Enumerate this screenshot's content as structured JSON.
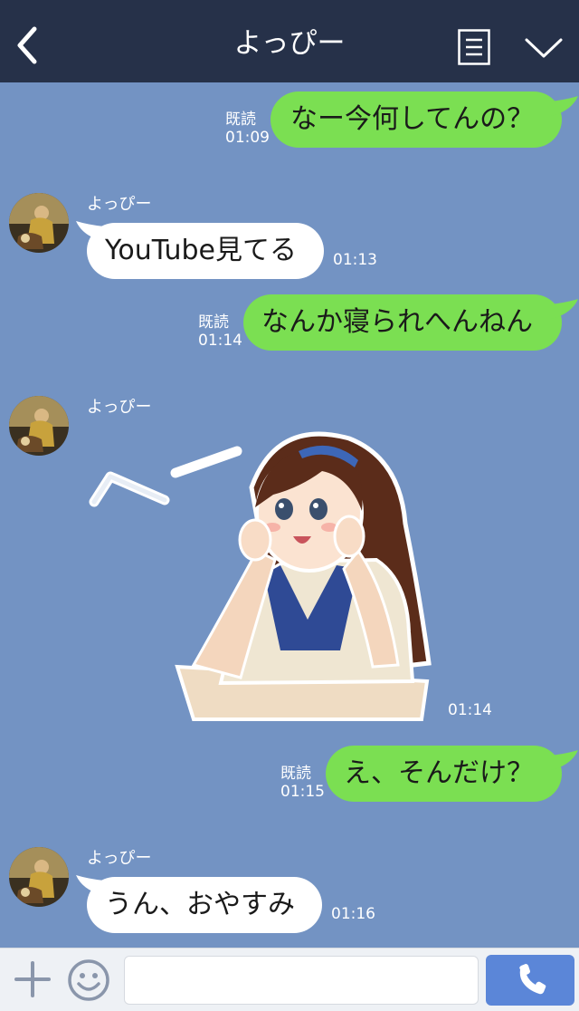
{
  "header": {
    "title": "よっぴー",
    "back_icon": "chevron-left-icon",
    "menu_icon": "notes-icon",
    "collapse_icon": "chevron-down-icon",
    "background": "#263149"
  },
  "chat": {
    "background": "#7393c3",
    "messages": [
      {
        "direction": "outgoing",
        "text": "なー今何してんの？",
        "read_label": "既読",
        "time": "01:09"
      },
      {
        "direction": "incoming",
        "sender": "よっぴー",
        "text": "YouTube見てる",
        "time": "01:13"
      },
      {
        "direction": "outgoing",
        "text": "なんか寝られへんねん",
        "read_label": "既読",
        "time": "01:14"
      },
      {
        "direction": "incoming",
        "sender": "よっぴー",
        "type": "sticker",
        "sticker_text": "へー",
        "time": "01:14"
      },
      {
        "direction": "outgoing",
        "text": "え、そんだけ？",
        "read_label": "既読",
        "time": "01:15"
      },
      {
        "direction": "incoming",
        "sender": "よっぴー",
        "text": "うん、おやすみ",
        "time": "01:16"
      }
    ]
  },
  "input_bar": {
    "plus_icon": "plus-icon",
    "emoji_icon": "smiley-icon",
    "placeholder": "",
    "value": "",
    "call_icon": "phone-icon"
  },
  "colors": {
    "outgoing_bubble": "#7bdf52",
    "incoming_bubble": "#ffffff",
    "call_button": "#5b86d8"
  }
}
